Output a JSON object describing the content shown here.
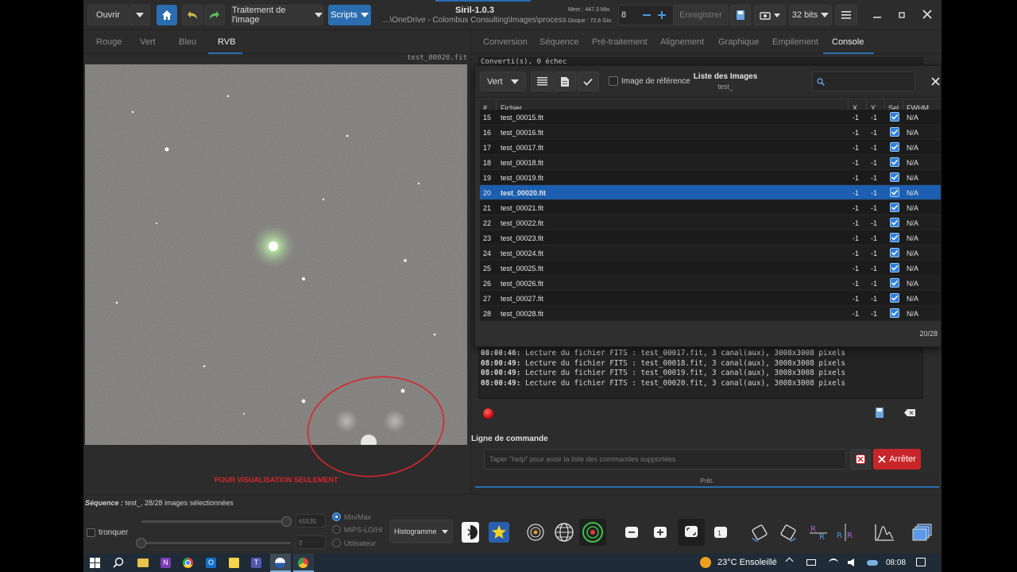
{
  "toolbar": {
    "open": "Ouvrir",
    "image_processing": "Traitement de l'image",
    "scripts": "Scripts",
    "title": "Siril-1.0.3",
    "path": "...\\OneDrive - Colombus Consulting\\Images\\process",
    "mem": "Mem : 447.3 Mio",
    "disk": "Disque : 72.6 Gio",
    "threads": "8",
    "save": "Enregistrer",
    "bits": "32 bits"
  },
  "left_tabs": [
    "Rouge",
    "Vert",
    "Bleu",
    "RVB"
  ],
  "image_name": "test_00020.fit",
  "viz_only": "POUR VISUALISATION SEULEMENT",
  "right_tabs": [
    "Conversion",
    "Séquence",
    "Pré-traitement",
    "Alignement",
    "Graphique",
    "Empilement",
    "Console"
  ],
  "console_top": "Converti(s), 0 échec",
  "dialog": {
    "channel": "Vert",
    "ref_label": "Image de référence",
    "title": "Liste des Images",
    "subtitle": "test_",
    "headers": [
      "#",
      "Fichier",
      "X",
      "Y",
      "Sel",
      "FWHM"
    ],
    "rows": [
      {
        "n": "15",
        "f": "test_00015.fit",
        "x": "-1",
        "y": "-1",
        "fwhm": "N/A"
      },
      {
        "n": "16",
        "f": "test_00016.fit",
        "x": "-1",
        "y": "-1",
        "fwhm": "N/A"
      },
      {
        "n": "17",
        "f": "test_00017.fit",
        "x": "-1",
        "y": "-1",
        "fwhm": "N/A"
      },
      {
        "n": "18",
        "f": "test_00018.fit",
        "x": "-1",
        "y": "-1",
        "fwhm": "N/A"
      },
      {
        "n": "19",
        "f": "test_00019.fit",
        "x": "-1",
        "y": "-1",
        "fwhm": "N/A"
      },
      {
        "n": "20",
        "f": "test_00020.fit",
        "x": "-1",
        "y": "-1",
        "fwhm": "N/A",
        "selected": true
      },
      {
        "n": "21",
        "f": "test_00021.fit",
        "x": "-1",
        "y": "-1",
        "fwhm": "N/A"
      },
      {
        "n": "22",
        "f": "test_00022.fit",
        "x": "-1",
        "y": "-1",
        "fwhm": "N/A"
      },
      {
        "n": "23",
        "f": "test_00023.fit",
        "x": "-1",
        "y": "-1",
        "fwhm": "N/A"
      },
      {
        "n": "24",
        "f": "test_00024.fit",
        "x": "-1",
        "y": "-1",
        "fwhm": "N/A"
      },
      {
        "n": "25",
        "f": "test_00025.fit",
        "x": "-1",
        "y": "-1",
        "fwhm": "N/A"
      },
      {
        "n": "26",
        "f": "test_00026.fit",
        "x": "-1",
        "y": "-1",
        "fwhm": "N/A"
      },
      {
        "n": "27",
        "f": "test_00027.fit",
        "x": "-1",
        "y": "-1",
        "fwhm": "N/A"
      },
      {
        "n": "28",
        "f": "test_00028.fit",
        "x": "-1",
        "y": "-1",
        "fwhm": "N/A"
      }
    ],
    "count": "20/28"
  },
  "log": [
    {
      "t": "08:00:46:",
      "m": " Lecture du fichier FITS : test_00017.fit, 3 canal(aux), 3008x3008 pixels"
    },
    {
      "t": "08:00:49:",
      "m": " Lecture du fichier FITS : test_00018.fit, 3 canal(aux), 3008x3008 pixels"
    },
    {
      "t": "08:00:49:",
      "m": " Lecture du fichier FITS : test_00019.fit, 3 canal(aux), 3008x3008 pixels"
    },
    {
      "t": "08:00:49:",
      "m": " Lecture du fichier FITS : test_00020.fit, 3 canal(aux), 3008x3008 pixels"
    }
  ],
  "cmd": {
    "label": "Ligne de commande",
    "placeholder": "Taper \"help\" pour avoir la liste des commandes supportées",
    "stop": "Arrêter",
    "status": "Prêt."
  },
  "bottom": {
    "seq_label": "Séquence :",
    "seq_text": " test_, 28/28 images sélectionnées",
    "truncate": "tronquer",
    "max": "65535",
    "min": "0",
    "minmax": "Min/Max",
    "mips": "MIPS-LO/HI",
    "user": "Utilisateur",
    "histo": "Histogramme"
  },
  "taskbar": {
    "weather": "23°C  Ensoleillé",
    "time": "08:08"
  },
  "colors": {
    "accent": "#2a6db0",
    "stop": "#c8252a",
    "annot": "#d8262a"
  }
}
